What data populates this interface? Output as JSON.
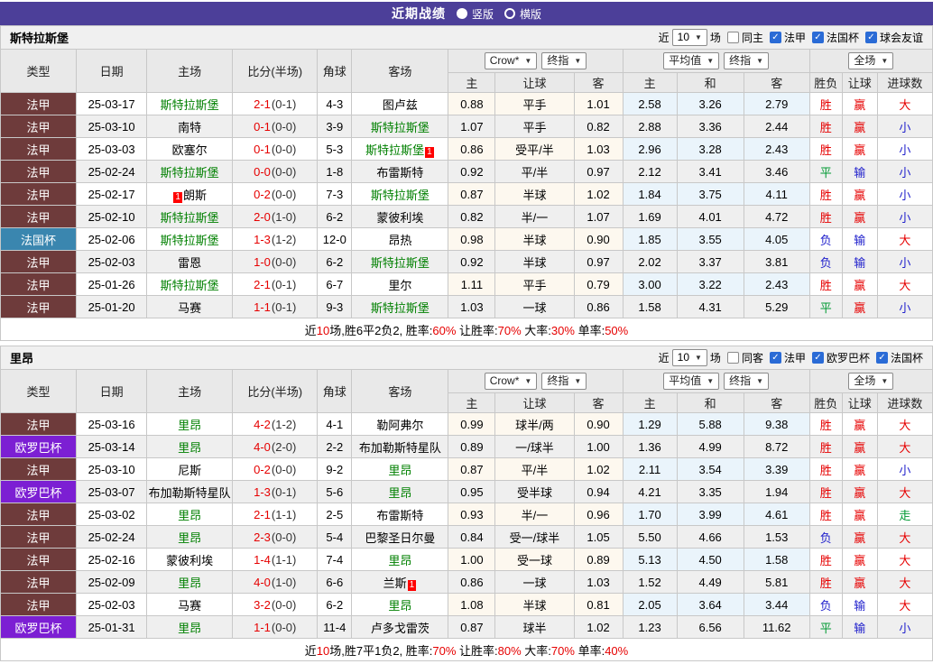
{
  "banner": {
    "title": "近期战绩",
    "vertical_label": "竖版",
    "horizontal_label": "横版",
    "selected_layout": "竖版"
  },
  "colors": {
    "banner_bg": "#4c3f99",
    "league": {
      "法甲": "#6e3b3b",
      "法国杯": "#3a86af",
      "欧罗巴杯": "#7c1fd3"
    },
    "self_team_green": "#008000",
    "score_red": "#e60000",
    "result_red": "#e60000",
    "result_blue": "#2121cc",
    "result_green": "#009933"
  },
  "table_header": {
    "cols": [
      "类型",
      "日期",
      "主场",
      "比分(半场)",
      "角球",
      "客场"
    ],
    "sub": [
      "主",
      "让球",
      "客",
      "主",
      "和",
      "客",
      "胜负",
      "让球",
      "进球数"
    ],
    "odds_source": "Crow*",
    "odds_stage": "终指",
    "avg_source": "平均值",
    "avg_stage": "终指",
    "scope": "全场"
  },
  "sections": [
    {
      "team": "斯特拉斯堡",
      "filter": {
        "prefix": "近",
        "count": "10",
        "suffix": "场",
        "same": "同主",
        "same_checked": false,
        "leagues": [
          "法甲",
          "法国杯",
          "球会友谊"
        ]
      },
      "rows": [
        {
          "type": "法甲",
          "date": "25-03-17",
          "home": "斯特拉斯堡",
          "score": "2-1",
          "half": "(0-1)",
          "corners": "4-3",
          "away": "图卢兹",
          "odds": [
            "0.88",
            "平手",
            "1.01"
          ],
          "avg": [
            "2.58",
            "3.26",
            "2.79"
          ],
          "result": [
            "胜",
            "赢",
            "大"
          ]
        },
        {
          "type": "法甲",
          "date": "25-03-10",
          "home": "南特",
          "score": "0-1",
          "half": "(0-0)",
          "corners": "3-9",
          "away": "斯特拉斯堡",
          "odds": [
            "1.07",
            "平手",
            "0.82"
          ],
          "avg": [
            "2.88",
            "3.36",
            "2.44"
          ],
          "result": [
            "胜",
            "赢",
            "小"
          ]
        },
        {
          "type": "法甲",
          "date": "25-03-03",
          "home": "欧塞尔",
          "score": "0-1",
          "half": "(0-0)",
          "corners": "5-3",
          "away": "斯特拉斯堡",
          "away_badge": "1",
          "odds": [
            "0.86",
            "受平/半",
            "1.03"
          ],
          "avg": [
            "2.96",
            "3.28",
            "2.43"
          ],
          "result": [
            "胜",
            "赢",
            "小"
          ]
        },
        {
          "type": "法甲",
          "date": "25-02-24",
          "home": "斯特拉斯堡",
          "score": "0-0",
          "half": "(0-0)",
          "corners": "1-8",
          "away": "布雷斯特",
          "odds": [
            "0.92",
            "平/半",
            "0.97"
          ],
          "avg": [
            "2.12",
            "3.41",
            "3.46"
          ],
          "result": [
            "平",
            "输",
            "小"
          ]
        },
        {
          "type": "法甲",
          "date": "25-02-17",
          "home": "朗斯",
          "home_badge": "1",
          "home_badge_pos": "before",
          "score": "0-2",
          "half": "(0-0)",
          "corners": "7-3",
          "away": "斯特拉斯堡",
          "odds": [
            "0.87",
            "半球",
            "1.02"
          ],
          "avg": [
            "1.84",
            "3.75",
            "4.11"
          ],
          "result": [
            "胜",
            "赢",
            "小"
          ]
        },
        {
          "type": "法甲",
          "date": "25-02-10",
          "home": "斯特拉斯堡",
          "score": "2-0",
          "half": "(1-0)",
          "corners": "6-2",
          "away": "蒙彼利埃",
          "odds": [
            "0.82",
            "半/一",
            "1.07"
          ],
          "avg": [
            "1.69",
            "4.01",
            "4.72"
          ],
          "result": [
            "胜",
            "赢",
            "小"
          ]
        },
        {
          "type": "法国杯",
          "date": "25-02-06",
          "home": "斯特拉斯堡",
          "score": "1-3",
          "half": "(1-2)",
          "corners": "12-0",
          "away": "昂热",
          "odds": [
            "0.98",
            "半球",
            "0.90"
          ],
          "avg": [
            "1.85",
            "3.55",
            "4.05"
          ],
          "result": [
            "负",
            "输",
            "大"
          ]
        },
        {
          "type": "法甲",
          "date": "25-02-03",
          "home": "雷恩",
          "score": "1-0",
          "half": "(0-0)",
          "corners": "6-2",
          "away": "斯特拉斯堡",
          "odds": [
            "0.92",
            "半球",
            "0.97"
          ],
          "avg": [
            "2.02",
            "3.37",
            "3.81"
          ],
          "result": [
            "负",
            "输",
            "小"
          ]
        },
        {
          "type": "法甲",
          "date": "25-01-26",
          "home": "斯特拉斯堡",
          "score": "2-1",
          "half": "(0-1)",
          "corners": "6-7",
          "away": "里尔",
          "odds": [
            "1.11",
            "平手",
            "0.79"
          ],
          "avg": [
            "3.00",
            "3.22",
            "2.43"
          ],
          "result": [
            "胜",
            "赢",
            "大"
          ]
        },
        {
          "type": "法甲",
          "date": "25-01-20",
          "home": "马赛",
          "score": "1-1",
          "half": "(0-1)",
          "corners": "9-3",
          "away": "斯特拉斯堡",
          "odds": [
            "1.03",
            "一球",
            "0.86"
          ],
          "avg": [
            "1.58",
            "4.31",
            "5.29"
          ],
          "result": [
            "平",
            "赢",
            "小"
          ]
        }
      ],
      "summary": {
        "parts": [
          {
            "t": "近"
          },
          {
            "t": "10",
            "hl": true
          },
          {
            "t": "场,胜6平2负2, 胜率:"
          },
          {
            "t": "60%",
            "hl": true
          },
          {
            "t": " 让胜率:"
          },
          {
            "t": "70%",
            "hl": true
          },
          {
            "t": " 大率:"
          },
          {
            "t": "30%",
            "hl": true
          },
          {
            "t": " 单率:"
          },
          {
            "t": "50%",
            "hl": true
          }
        ]
      }
    },
    {
      "team": "里昂",
      "filter": {
        "prefix": "近",
        "count": "10",
        "suffix": "场",
        "same": "同客",
        "same_checked": false,
        "leagues": [
          "法甲",
          "欧罗巴杯",
          "法国杯"
        ]
      },
      "rows": [
        {
          "type": "法甲",
          "date": "25-03-16",
          "home": "里昂",
          "score": "4-2",
          "half": "(1-2)",
          "corners": "4-1",
          "away": "勒阿弗尔",
          "odds": [
            "0.99",
            "球半/两",
            "0.90"
          ],
          "avg": [
            "1.29",
            "5.88",
            "9.38"
          ],
          "result": [
            "胜",
            "赢",
            "大"
          ]
        },
        {
          "type": "欧罗巴杯",
          "date": "25-03-14",
          "home": "里昂",
          "score": "4-0",
          "half": "(2-0)",
          "corners": "2-2",
          "away": "布加勒斯特星队",
          "odds": [
            "0.89",
            "一/球半",
            "1.00"
          ],
          "avg": [
            "1.36",
            "4.99",
            "8.72"
          ],
          "result": [
            "胜",
            "赢",
            "大"
          ]
        },
        {
          "type": "法甲",
          "date": "25-03-10",
          "home": "尼斯",
          "score": "0-2",
          "half": "(0-0)",
          "corners": "9-2",
          "away": "里昂",
          "odds": [
            "0.87",
            "平/半",
            "1.02"
          ],
          "avg": [
            "2.11",
            "3.54",
            "3.39"
          ],
          "result": [
            "胜",
            "赢",
            "小"
          ]
        },
        {
          "type": "欧罗巴杯",
          "date": "25-03-07",
          "home": "布加勒斯特星队",
          "score": "1-3",
          "half": "(0-1)",
          "corners": "5-6",
          "away": "里昂",
          "odds": [
            "0.95",
            "受半球",
            "0.94"
          ],
          "avg": [
            "4.21",
            "3.35",
            "1.94"
          ],
          "result": [
            "胜",
            "赢",
            "大"
          ]
        },
        {
          "type": "法甲",
          "date": "25-03-02",
          "home": "里昂",
          "score": "2-1",
          "half": "(1-1)",
          "corners": "2-5",
          "away": "布雷斯特",
          "odds": [
            "0.93",
            "半/一",
            "0.96"
          ],
          "avg": [
            "1.70",
            "3.99",
            "4.61"
          ],
          "result": [
            "胜",
            "赢",
            "走"
          ]
        },
        {
          "type": "法甲",
          "date": "25-02-24",
          "home": "里昂",
          "score": "2-3",
          "half": "(0-0)",
          "corners": "5-4",
          "away": "巴黎圣日尔曼",
          "odds": [
            "0.84",
            "受一/球半",
            "1.05"
          ],
          "avg": [
            "5.50",
            "4.66",
            "1.53"
          ],
          "result": [
            "负",
            "赢",
            "大"
          ]
        },
        {
          "type": "法甲",
          "date": "25-02-16",
          "home": "蒙彼利埃",
          "score": "1-4",
          "half": "(1-1)",
          "corners": "7-4",
          "away": "里昂",
          "odds": [
            "1.00",
            "受一球",
            "0.89"
          ],
          "avg": [
            "5.13",
            "4.50",
            "1.58"
          ],
          "result": [
            "胜",
            "赢",
            "大"
          ]
        },
        {
          "type": "法甲",
          "date": "25-02-09",
          "home": "里昂",
          "score": "4-0",
          "half": "(1-0)",
          "corners": "6-6",
          "away": "兰斯",
          "away_badge": "1",
          "odds": [
            "0.86",
            "一球",
            "1.03"
          ],
          "avg": [
            "1.52",
            "4.49",
            "5.81"
          ],
          "result": [
            "胜",
            "赢",
            "大"
          ]
        },
        {
          "type": "法甲",
          "date": "25-02-03",
          "home": "马赛",
          "score": "3-2",
          "half": "(0-0)",
          "corners": "6-2",
          "away": "里昂",
          "odds": [
            "1.08",
            "半球",
            "0.81"
          ],
          "avg": [
            "2.05",
            "3.64",
            "3.44"
          ],
          "result": [
            "负",
            "输",
            "大"
          ]
        },
        {
          "type": "欧罗巴杯",
          "date": "25-01-31",
          "home": "里昂",
          "score": "1-1",
          "half": "(0-0)",
          "corners": "11-4",
          "away": "卢多戈雷茨",
          "odds": [
            "0.87",
            "球半",
            "1.02"
          ],
          "avg": [
            "1.23",
            "6.56",
            "11.62"
          ],
          "result": [
            "平",
            "输",
            "小"
          ]
        }
      ],
      "summary": {
        "parts": [
          {
            "t": "近"
          },
          {
            "t": "10",
            "hl": true
          },
          {
            "t": "场,胜7平1负2, 胜率:"
          },
          {
            "t": "70%",
            "hl": true
          },
          {
            "t": " 让胜率:"
          },
          {
            "t": "80%",
            "hl": true
          },
          {
            "t": " 大率:"
          },
          {
            "t": "70%",
            "hl": true
          },
          {
            "t": " 单率:"
          },
          {
            "t": "40%",
            "hl": true
          }
        ]
      }
    }
  ]
}
